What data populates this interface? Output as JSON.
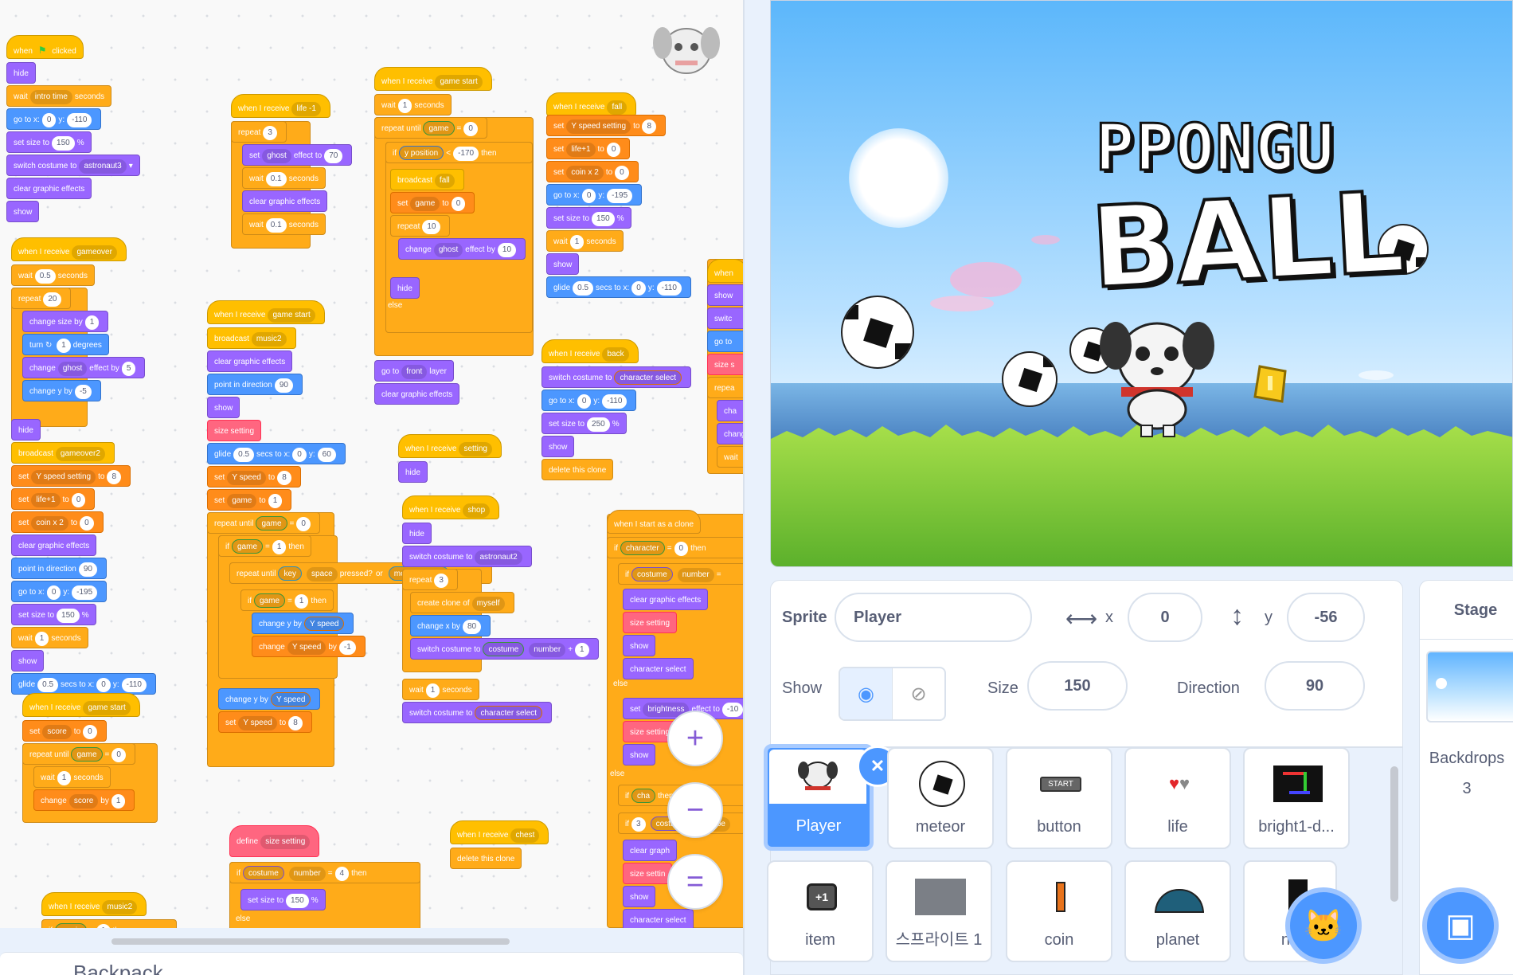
{
  "code": {
    "when_flag": [
      "when",
      "clicked"
    ],
    "hide": "hide",
    "wait_intro": [
      "wait",
      "intro time",
      "seconds"
    ],
    "goto1": [
      "go to x:",
      "0",
      "y:",
      "-110"
    ],
    "setsize1": [
      "set size to",
      "150",
      "%"
    ],
    "switch_astro3": [
      "switch costume to",
      "astronaut3"
    ],
    "clear": "clear graphic effects",
    "show": "show",
    "recv_gameover": [
      "when I receive",
      "gameover"
    ],
    "wait05": [
      "wait",
      "0.5",
      "seconds"
    ],
    "repeat20": [
      "repeat",
      "20"
    ],
    "change_size": [
      "change size by",
      "1"
    ],
    "turn": [
      "turn",
      "1",
      "degrees"
    ],
    "change_ghost5": [
      "change",
      "ghost",
      "effect by",
      "5"
    ],
    "change_y": [
      "change y by",
      "-5"
    ],
    "broadcast_gameover2": [
      "broadcast",
      "gameover2"
    ],
    "set_yspeed8": [
      "set",
      "Y speed setting",
      "to",
      "8"
    ],
    "set_life0": [
      "set",
      "life+1",
      "to",
      "0"
    ],
    "set_coin0": [
      "set",
      "coin x 2",
      "to",
      "0"
    ],
    "point90": [
      "point in direction",
      "90"
    ],
    "goto195": [
      "go to x:",
      "0",
      "y:",
      "-195"
    ],
    "wait1": [
      "wait",
      "1",
      "seconds"
    ],
    "glide": [
      "glide",
      "0.5",
      "secs to x:",
      "0",
      "y:",
      "-110"
    ],
    "recv_gamestart": [
      "when I receive",
      "game start"
    ],
    "set_score0": [
      "set",
      "score",
      "to",
      "0"
    ],
    "repeat_until_game0": [
      "repeat until",
      "game",
      "=",
      "0"
    ],
    "change_score": [
      "change",
      "score",
      "by",
      "1"
    ],
    "recv_music2": [
      "when I receive",
      "music2"
    ],
    "if_music": [
      "if",
      "music",
      "=",
      "1",
      "then"
    ],
    "recv_life": [
      "when I receive",
      "life -1"
    ],
    "repeat3": [
      "repeat",
      "3"
    ],
    "set_ghost70": [
      "set",
      "ghost",
      "effect to",
      "70"
    ],
    "wait01": [
      "wait",
      "0.1",
      "seconds"
    ],
    "broadcast_music2": [
      "broadcast",
      "music2"
    ],
    "point_dir": [
      "point in direction",
      "90"
    ],
    "size_setting": "size setting",
    "glide60": [
      "glide",
      "0.5",
      "secs to x:",
      "0",
      "y:",
      "60"
    ],
    "set_yspeed": [
      "set",
      "Y speed",
      "to",
      "8"
    ],
    "set_game1": [
      "set",
      "game",
      "to",
      "1"
    ],
    "if_game1": [
      "if",
      "game",
      "=",
      "1",
      "then"
    ],
    "repeat_until_key": [
      "repeat until",
      "key",
      "space",
      "pressed?",
      "or",
      "mouse down?"
    ],
    "change_y_speed": [
      "change y by",
      "Y speed"
    ],
    "change_yspeed_neg": [
      "change",
      "Y speed",
      "by",
      "-1"
    ],
    "define": [
      "define",
      "size setting"
    ],
    "if_costume4": [
      "if",
      "costume",
      "number",
      "=",
      "4",
      "then"
    ],
    "setsize150": [
      "set size to",
      "150",
      "%"
    ],
    "else": "else",
    "if_ypos": [
      "if",
      "y position",
      "<",
      "-170",
      "then"
    ],
    "broadcast_fall": [
      "broadcast",
      "fall"
    ],
    "set_game0": [
      "set",
      "game",
      "to",
      "0"
    ],
    "repeat10": [
      "repeat",
      "10"
    ],
    "change_ghost10": [
      "change",
      "ghost",
      "effect by",
      "10"
    ],
    "goto_front": [
      "go to",
      "front",
      "layer"
    ],
    "recv_setting": [
      "when I receive",
      "setting"
    ],
    "recv_shop": [
      "when I receive",
      "shop"
    ],
    "switch_astro2": [
      "switch costume to",
      "astronaut2"
    ],
    "create_clone": [
      "create clone of",
      "myself"
    ],
    "change_x": [
      "change x by",
      "80"
    ],
    "switch_num": [
      "switch costume to",
      "costume",
      "number",
      "+",
      "1"
    ],
    "switch_charsel": [
      "switch costume to",
      "character select"
    ],
    "recv_chest": [
      "when I receive",
      "chest"
    ],
    "delete_clone": "delete this clone",
    "recv_fall": [
      "when I receive",
      "fall"
    ],
    "set_yss8": [
      "set",
      "Y speed setting",
      "to",
      "8"
    ],
    "goto_195": [
      "go to x:",
      "0",
      "y:",
      "-195"
    ],
    "wait_1": [
      "wait",
      "1",
      "seconds"
    ],
    "recv_back": [
      "when I receive",
      "back"
    ],
    "goto_110": [
      "go to x:",
      "0",
      "y:",
      "-110"
    ],
    "setsize250": [
      "set size to",
      "250",
      "%"
    ],
    "clone_start": "when I start as a clone",
    "if_char0": [
      "if",
      "character",
      "=",
      "0",
      "then"
    ],
    "if_costume": [
      "if",
      "costume",
      "number",
      "="
    ],
    "char_select": "character select",
    "set_bright": [
      "set",
      "brightness",
      "effect to",
      "-10"
    ],
    "if_cha": [
      "if",
      "cha",
      "then"
    ],
    "costume_number": [
      "3",
      "costume",
      "numbe"
    ],
    "clear_graph": "clear graph",
    "size_settin": "size settin",
    "when_edge": "when",
    "show_edge": "show",
    "switch_edge": "switc",
    "goto_edge": "go to",
    "size_edge": "size s",
    "repeat_edge": "repea",
    "cha_edge": "cha",
    "change_edge": "chang",
    "wait_edge": "wait"
  },
  "zoom": {
    "in": "+",
    "out": "−",
    "reset": "="
  },
  "backpack": "Backpack",
  "stage": {
    "title1": "PPONGU",
    "title2": "BALL"
  },
  "sprite_info": {
    "sprite_label": "Sprite",
    "sprite_name": "Player",
    "x_label": "x",
    "x_value": "0",
    "y_label": "y",
    "y_value": "-56",
    "show_label": "Show",
    "size_label": "Size",
    "size_value": "150",
    "direction_label": "Direction",
    "direction_value": "90"
  },
  "sprites": [
    "Player",
    "meteor",
    "button",
    "life",
    "bright1-d...",
    "item",
    "스프라이트 1",
    "coin",
    "planet",
    "nu"
  ],
  "button_thumb_text": "START",
  "item_thumb_text": "+1",
  "stage_pane": {
    "title": "Stage",
    "backdrops_label": "Backdrops",
    "backdrops_count": "3"
  }
}
